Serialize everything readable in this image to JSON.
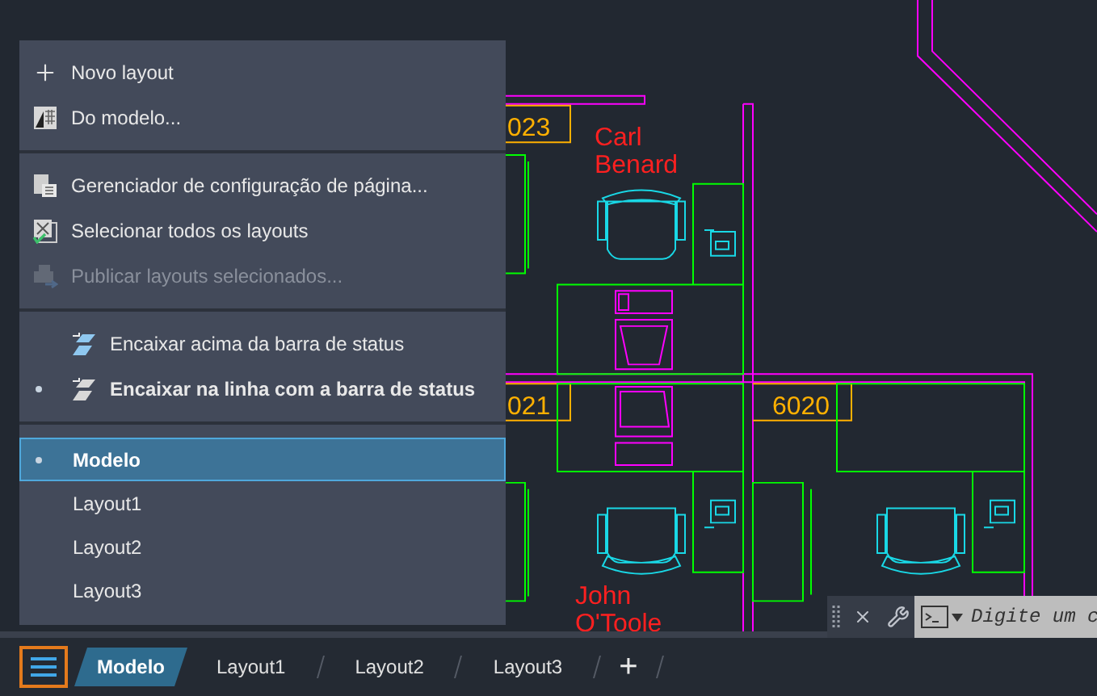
{
  "drawing": {
    "labels": [
      {
        "kind": "room",
        "text": "023"
      },
      {
        "kind": "name",
        "text": "Carl"
      },
      {
        "kind": "name",
        "text": "Benard"
      },
      {
        "kind": "room",
        "text": "021"
      },
      {
        "kind": "room",
        "text": "6020"
      },
      {
        "kind": "name",
        "text": "John"
      },
      {
        "kind": "name",
        "text": "O'Toole"
      }
    ]
  },
  "menu": {
    "sections": [
      {
        "items": [
          {
            "label": "Novo layout",
            "disabled": false
          },
          {
            "label": "Do modelo...",
            "disabled": false
          }
        ]
      },
      {
        "items": [
          {
            "label": "Gerenciador de configuração de página...",
            "disabled": false
          },
          {
            "label": "Selecionar todos os layouts",
            "disabled": false
          },
          {
            "label": "Publicar layouts selecionados...",
            "disabled": true
          }
        ]
      },
      {
        "kind": "dock",
        "items": [
          {
            "label": "Encaixar acima da barra de status",
            "selected": false
          },
          {
            "label": "Encaixar na linha com a barra de status",
            "selected": true
          }
        ]
      },
      {
        "kind": "layouts",
        "items": [
          {
            "label": "Modelo",
            "selected": true
          },
          {
            "label": "Layout1",
            "selected": false
          },
          {
            "label": "Layout2",
            "selected": false
          },
          {
            "label": "Layout3",
            "selected": false
          }
        ]
      }
    ]
  },
  "command_line": {
    "placeholder": "Digite um c"
  },
  "layout_bar": {
    "menu_open": true,
    "tabs": [
      {
        "label": "Modelo",
        "selected": true
      },
      {
        "label": "Layout1",
        "selected": false
      },
      {
        "label": "Layout2",
        "selected": false
      },
      {
        "label": "Layout3",
        "selected": false
      }
    ],
    "add": "+"
  }
}
